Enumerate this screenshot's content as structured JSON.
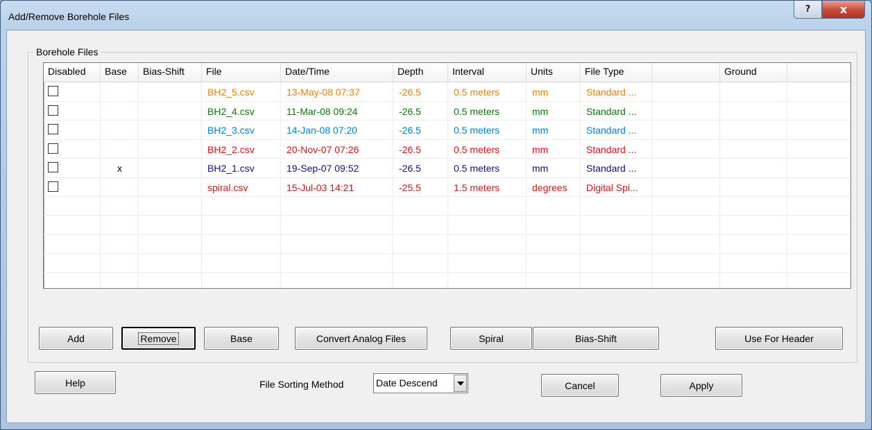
{
  "window": {
    "title": "Add/Remove Borehole Files",
    "help_glyph": "?",
    "close_glyph": "x"
  },
  "group": {
    "label": "Borehole Files"
  },
  "columns": [
    "Disabled",
    "Base",
    "Bias-Shift",
    "File",
    "Date/Time",
    "Depth",
    "Interval",
    "Units",
    "File Type",
    "",
    "Ground"
  ],
  "files": [
    {
      "base": "",
      "file": "BH2_5.csv",
      "datetime": "13-May-08 07:37",
      "depth": "-26.5",
      "interval": "0.5 meters",
      "units": "mm",
      "filetype": "Standard ...",
      "color": "#f08000"
    },
    {
      "base": "",
      "file": "BH2_4.csv",
      "datetime": "11-Mar-08 09:24",
      "depth": "-26.5",
      "interval": "0.5 meters",
      "units": "mm",
      "filetype": "Standard ...",
      "color": "#008000"
    },
    {
      "base": "",
      "file": "BH2_3.csv",
      "datetime": "14-Jan-08 07:20",
      "depth": "-26.5",
      "interval": "0.5 meters",
      "units": "mm",
      "filetype": "Standard ...",
      "color": "#0080e0"
    },
    {
      "base": "",
      "file": "BH2_2.csv",
      "datetime": "20-Nov-07 07:26",
      "depth": "-26.5",
      "interval": "0.5 meters",
      "units": "mm",
      "filetype": "Standard ...",
      "color": "#e81010"
    },
    {
      "base": "x",
      "file": "BH2_1.csv",
      "datetime": "19-Sep-07 09:52",
      "depth": "-26.5",
      "interval": "0.5 meters",
      "units": "mm",
      "filetype": "Standard ...",
      "color": "#101080"
    },
    {
      "base": "",
      "file": "spiral.csv",
      "datetime": "15-Jul-03 14:21",
      "depth": "-25.5",
      "interval": "1.5 meters",
      "units": "degrees",
      "filetype": "Digital Spi...",
      "color": "#e81010"
    }
  ],
  "buttons": {
    "add": "Add",
    "remove": "Remove",
    "base": "Base",
    "convert": "Convert Analog Files",
    "spiral": "Spiral",
    "bias_shift": "Bias-Shift",
    "use_for_header": "Use For Header",
    "help": "Help",
    "cancel": "Cancel",
    "apply": "Apply"
  },
  "sorting": {
    "label": "File Sorting Method",
    "value": "Date Descend"
  }
}
